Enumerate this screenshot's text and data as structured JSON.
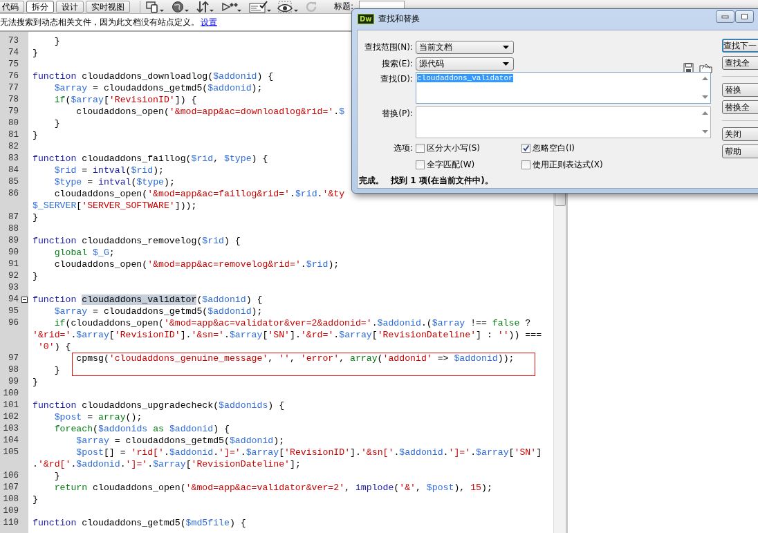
{
  "toolbar": {
    "tabs": [
      {
        "label": "代码",
        "selected": false
      },
      {
        "label": "拆分",
        "selected": true
      },
      {
        "label": "设计",
        "selected": false
      },
      {
        "label": "实时视图",
        "selected": false
      }
    ],
    "title_label": "标题:"
  },
  "info_bar": {
    "message": "无法搜索到动态相关文件，因为此文档没有站点定义。",
    "link": "设置"
  },
  "code": {
    "lines": [
      {
        "number": "73",
        "rows": [
          {
            "tokens": [
              {
                "kind": "plain",
                "text": "    }"
              }
            ]
          }
        ]
      },
      {
        "number": "74",
        "rows": [
          {
            "tokens": [
              {
                "kind": "plain",
                "text": "}"
              }
            ]
          }
        ]
      },
      {
        "number": "75"
      },
      {
        "number": "76",
        "rows": [
          {
            "tokens": [
              {
                "kind": "kw",
                "text": "function"
              },
              {
                "kind": "plain",
                "text": " cloudaddons_downloadlog("
              },
              {
                "kind": "var",
                "text": "$addonid"
              },
              {
                "kind": "plain",
                "text": ") {"
              }
            ]
          }
        ]
      },
      {
        "number": "77",
        "rows": [
          {
            "tokens": [
              {
                "kind": "var",
                "text": "    $array"
              },
              {
                "kind": "plain",
                "text": " = cloudaddons_getmd5("
              },
              {
                "kind": "var",
                "text": "$addonid"
              },
              {
                "kind": "plain",
                "text": ");"
              }
            ]
          }
        ]
      },
      {
        "number": "78",
        "rows": [
          {
            "tokens": [
              {
                "kind": "ctl",
                "text": "    if"
              },
              {
                "kind": "plain",
                "text": "("
              },
              {
                "kind": "var",
                "text": "$array"
              },
              {
                "kind": "plain",
                "text": "["
              },
              {
                "kind": "str",
                "text": "'RevisionID'"
              },
              {
                "kind": "plain",
                "text": "]) {"
              }
            ]
          }
        ]
      },
      {
        "number": "79",
        "rows": [
          {
            "tokens": [
              {
                "kind": "plain",
                "text": "        cloudaddons_open("
              },
              {
                "kind": "str",
                "text": "'&mod=app&ac=downloadlog&rid='"
              },
              {
                "kind": "plain",
                "text": "."
              },
              {
                "kind": "var",
                "text": "$"
              }
            ]
          }
        ]
      },
      {
        "number": "80",
        "rows": [
          {
            "tokens": [
              {
                "kind": "plain",
                "text": "    }"
              }
            ]
          }
        ]
      },
      {
        "number": "81",
        "rows": [
          {
            "tokens": [
              {
                "kind": "plain",
                "text": "}"
              }
            ]
          }
        ]
      },
      {
        "number": "82"
      },
      {
        "number": "83",
        "rows": [
          {
            "tokens": [
              {
                "kind": "kw",
                "text": "function"
              },
              {
                "kind": "plain",
                "text": " cloudaddons_faillog("
              },
              {
                "kind": "var",
                "text": "$rid"
              },
              {
                "kind": "plain",
                "text": ", "
              },
              {
                "kind": "var",
                "text": "$type"
              },
              {
                "kind": "plain",
                "text": ") {"
              }
            ]
          }
        ]
      },
      {
        "number": "84",
        "rows": [
          {
            "tokens": [
              {
                "kind": "var",
                "text": "    $rid"
              },
              {
                "kind": "plain",
                "text": " = "
              },
              {
                "kind": "kw",
                "text": "intval"
              },
              {
                "kind": "plain",
                "text": "("
              },
              {
                "kind": "var",
                "text": "$rid"
              },
              {
                "kind": "plain",
                "text": ");"
              }
            ]
          }
        ]
      },
      {
        "number": "85",
        "rows": [
          {
            "tokens": [
              {
                "kind": "var",
                "text": "    $type"
              },
              {
                "kind": "plain",
                "text": " = "
              },
              {
                "kind": "kw",
                "text": "intval"
              },
              {
                "kind": "plain",
                "text": "("
              },
              {
                "kind": "var",
                "text": "$type"
              },
              {
                "kind": "plain",
                "text": ");"
              }
            ]
          }
        ]
      },
      {
        "number": "86",
        "rows": [
          {
            "tokens": [
              {
                "kind": "plain",
                "text": "    cloudaddons_open("
              },
              {
                "kind": "str",
                "text": "'&mod=app&ac=faillog&rid='"
              },
              {
                "kind": "plain",
                "text": "."
              },
              {
                "kind": "var",
                "text": "$rid"
              },
              {
                "kind": "plain",
                "text": "."
              },
              {
                "kind": "str",
                "text": "'&ty"
              }
            ]
          },
          {
            "tokens": [
              {
                "kind": "var",
                "text": "$_SERVER"
              },
              {
                "kind": "plain",
                "text": "["
              },
              {
                "kind": "str",
                "text": "'SERVER_SOFTWARE'"
              },
              {
                "kind": "plain",
                "text": "]));"
              }
            ]
          }
        ]
      },
      {
        "number": "87",
        "rows": [
          {
            "tokens": [
              {
                "kind": "plain",
                "text": "}"
              }
            ]
          }
        ]
      },
      {
        "number": "88"
      },
      {
        "number": "89",
        "rows": [
          {
            "tokens": [
              {
                "kind": "kw",
                "text": "function"
              },
              {
                "kind": "plain",
                "text": " cloudaddons_removelog("
              },
              {
                "kind": "var",
                "text": "$rid"
              },
              {
                "kind": "plain",
                "text": ") {"
              }
            ]
          }
        ]
      },
      {
        "number": "90",
        "rows": [
          {
            "tokens": [
              {
                "kind": "ctl",
                "text": "    global"
              },
              {
                "kind": "var",
                "text": " $_G"
              },
              {
                "kind": "plain",
                "text": ";"
              }
            ]
          }
        ]
      },
      {
        "number": "91",
        "rows": [
          {
            "tokens": [
              {
                "kind": "plain",
                "text": "    cloudaddons_open("
              },
              {
                "kind": "str",
                "text": "'&mod=app&ac=removelog&rid='"
              },
              {
                "kind": "plain",
                "text": "."
              },
              {
                "kind": "var",
                "text": "$rid"
              },
              {
                "kind": "plain",
                "text": ");"
              }
            ]
          }
        ]
      },
      {
        "number": "92",
        "rows": [
          {
            "tokens": [
              {
                "kind": "plain",
                "text": "}"
              }
            ]
          }
        ]
      },
      {
        "number": "93"
      },
      {
        "number": "94",
        "fold": true,
        "rows": [
          {
            "tokens": [
              {
                "kind": "kw",
                "text": "function "
              },
              {
                "kind": "match",
                "text": "cloudaddons_validator"
              },
              {
                "kind": "plain",
                "text": "("
              },
              {
                "kind": "var",
                "text": "$addonid"
              },
              {
                "kind": "plain",
                "text": ") {"
              }
            ]
          }
        ]
      },
      {
        "number": "95",
        "rows": [
          {
            "tokens": [
              {
                "kind": "var",
                "text": "    $array"
              },
              {
                "kind": "plain",
                "text": " = cloudaddons_getmd5("
              },
              {
                "kind": "var",
                "text": "$addonid"
              },
              {
                "kind": "plain",
                "text": ");"
              }
            ]
          }
        ]
      },
      {
        "number": "96",
        "rows": [
          {
            "tokens": [
              {
                "kind": "ctl",
                "text": "    if"
              },
              {
                "kind": "plain",
                "text": "(cloudaddons_open("
              },
              {
                "kind": "str",
                "text": "'&mod=app&ac=validator&ver=2&addonid='"
              },
              {
                "kind": "plain",
                "text": "."
              },
              {
                "kind": "var",
                "text": "$addonid"
              },
              {
                "kind": "plain",
                "text": ".("
              },
              {
                "kind": "var",
                "text": "$array"
              },
              {
                "kind": "plain",
                "text": " !== "
              },
              {
                "kind": "ctl",
                "text": "false"
              },
              {
                "kind": "plain",
                "text": " ?"
              }
            ]
          },
          {
            "tokens": [
              {
                "kind": "str",
                "text": "'&rid='"
              },
              {
                "kind": "plain",
                "text": "."
              },
              {
                "kind": "var",
                "text": "$array"
              },
              {
                "kind": "plain",
                "text": "["
              },
              {
                "kind": "str",
                "text": "'RevisionID'"
              },
              {
                "kind": "plain",
                "text": "]."
              },
              {
                "kind": "str",
                "text": "'&sn='"
              },
              {
                "kind": "plain",
                "text": "."
              },
              {
                "kind": "var",
                "text": "$array"
              },
              {
                "kind": "plain",
                "text": "["
              },
              {
                "kind": "str",
                "text": "'SN'"
              },
              {
                "kind": "plain",
                "text": "]."
              },
              {
                "kind": "str",
                "text": "'&rd='"
              },
              {
                "kind": "plain",
                "text": "."
              },
              {
                "kind": "var",
                "text": "$array"
              },
              {
                "kind": "plain",
                "text": "["
              },
              {
                "kind": "str",
                "text": "'RevisionDateline'"
              },
              {
                "kind": "plain",
                "text": "] : "
              },
              {
                "kind": "str",
                "text": "''"
              },
              {
                "kind": "plain",
                "text": ")) ==="
              }
            ]
          },
          {
            "tokens": [
              {
                "kind": "str",
                "text": " '0'"
              },
              {
                "kind": "plain",
                "text": ") {"
              }
            ]
          }
        ]
      },
      {
        "number": "97",
        "boxed": true,
        "rows": [
          {
            "tokens": [
              {
                "kind": "plain",
                "text": "        cpmsg("
              },
              {
                "kind": "str",
                "text": "'cloudaddons_genuine_message'"
              },
              {
                "kind": "plain",
                "text": ", "
              },
              {
                "kind": "str",
                "text": "''"
              },
              {
                "kind": "plain",
                "text": ", "
              },
              {
                "kind": "str",
                "text": "'error'"
              },
              {
                "kind": "plain",
                "text": ", "
              },
              {
                "kind": "ctl",
                "text": "array"
              },
              {
                "kind": "plain",
                "text": "("
              },
              {
                "kind": "str",
                "text": "'addonid'"
              },
              {
                "kind": "plain",
                "text": " => "
              },
              {
                "kind": "var",
                "text": "$addonid"
              },
              {
                "kind": "plain",
                "text": "));"
              }
            ]
          }
        ]
      },
      {
        "number": "98",
        "boxed": true,
        "rows": [
          {
            "tokens": [
              {
                "kind": "plain",
                "text": "    }"
              }
            ]
          }
        ]
      },
      {
        "number": "99",
        "rows": [
          {
            "tokens": [
              {
                "kind": "plain",
                "text": "}"
              }
            ]
          }
        ]
      },
      {
        "number": "100"
      },
      {
        "number": "101",
        "rows": [
          {
            "tokens": [
              {
                "kind": "kw",
                "text": "function"
              },
              {
                "kind": "plain",
                "text": " cloudaddons_upgradecheck("
              },
              {
                "kind": "var",
                "text": "$addonids"
              },
              {
                "kind": "plain",
                "text": ") {"
              }
            ]
          }
        ]
      },
      {
        "number": "102",
        "rows": [
          {
            "tokens": [
              {
                "kind": "var",
                "text": "    $post"
              },
              {
                "kind": "plain",
                "text": " = "
              },
              {
                "kind": "ctl",
                "text": "array"
              },
              {
                "kind": "plain",
                "text": "();"
              }
            ]
          }
        ]
      },
      {
        "number": "103",
        "rows": [
          {
            "tokens": [
              {
                "kind": "ctl",
                "text": "    foreach"
              },
              {
                "kind": "plain",
                "text": "("
              },
              {
                "kind": "var",
                "text": "$addonids"
              },
              {
                "kind": "ctl",
                "text": " as"
              },
              {
                "kind": "var",
                "text": " $addonid"
              },
              {
                "kind": "plain",
                "text": ") {"
              }
            ]
          }
        ]
      },
      {
        "number": "104",
        "rows": [
          {
            "tokens": [
              {
                "kind": "var",
                "text": "        $array"
              },
              {
                "kind": "plain",
                "text": " = cloudaddons_getmd5("
              },
              {
                "kind": "var",
                "text": "$addonid"
              },
              {
                "kind": "plain",
                "text": ");"
              }
            ]
          }
        ]
      },
      {
        "number": "105",
        "rows": [
          {
            "tokens": [
              {
                "kind": "var",
                "text": "        $post"
              },
              {
                "kind": "plain",
                "text": "[] = "
              },
              {
                "kind": "str",
                "text": "'rid['"
              },
              {
                "kind": "plain",
                "text": "."
              },
              {
                "kind": "var",
                "text": "$addonid"
              },
              {
                "kind": "plain",
                "text": "."
              },
              {
                "kind": "str",
                "text": "']='"
              },
              {
                "kind": "plain",
                "text": "."
              },
              {
                "kind": "var",
                "text": "$array"
              },
              {
                "kind": "plain",
                "text": "["
              },
              {
                "kind": "str",
                "text": "'RevisionID'"
              },
              {
                "kind": "plain",
                "text": "]."
              },
              {
                "kind": "str",
                "text": "'&sn['"
              },
              {
                "kind": "plain",
                "text": "."
              },
              {
                "kind": "var",
                "text": "$addonid"
              },
              {
                "kind": "plain",
                "text": "."
              },
              {
                "kind": "str",
                "text": "']='"
              },
              {
                "kind": "plain",
                "text": "."
              },
              {
                "kind": "var",
                "text": "$array"
              },
              {
                "kind": "plain",
                "text": "["
              },
              {
                "kind": "str",
                "text": "'SN'"
              },
              {
                "kind": "plain",
                "text": "]"
              }
            ]
          },
          {
            "tokens": [
              {
                "kind": "plain",
                "text": "."
              },
              {
                "kind": "str",
                "text": "'&rd['"
              },
              {
                "kind": "plain",
                "text": "."
              },
              {
                "kind": "var",
                "text": "$addonid"
              },
              {
                "kind": "plain",
                "text": "."
              },
              {
                "kind": "str",
                "text": "']='"
              },
              {
                "kind": "plain",
                "text": "."
              },
              {
                "kind": "var",
                "text": "$array"
              },
              {
                "kind": "plain",
                "text": "["
              },
              {
                "kind": "str",
                "text": "'RevisionDateline'"
              },
              {
                "kind": "plain",
                "text": "];"
              }
            ]
          }
        ]
      },
      {
        "number": "106",
        "rows": [
          {
            "tokens": [
              {
                "kind": "plain",
                "text": "    }"
              }
            ]
          }
        ]
      },
      {
        "number": "107",
        "rows": [
          {
            "tokens": [
              {
                "kind": "ctl",
                "text": "    return"
              },
              {
                "kind": "plain",
                "text": " cloudaddons_open("
              },
              {
                "kind": "str",
                "text": "'&mod=app&ac=validator&ver=2'"
              },
              {
                "kind": "plain",
                "text": ", "
              },
              {
                "kind": "kw",
                "text": "implode"
              },
              {
                "kind": "plain",
                "text": "("
              },
              {
                "kind": "str",
                "text": "'&'"
              },
              {
                "kind": "plain",
                "text": ", "
              },
              {
                "kind": "var",
                "text": "$post"
              },
              {
                "kind": "plain",
                "text": "), "
              },
              {
                "kind": "num",
                "text": "15"
              },
              {
                "kind": "plain",
                "text": ");"
              }
            ]
          }
        ]
      },
      {
        "number": "108",
        "rows": [
          {
            "tokens": [
              {
                "kind": "plain",
                "text": "}"
              }
            ]
          }
        ]
      },
      {
        "number": "109"
      },
      {
        "number": "110",
        "rows": [
          {
            "tokens": [
              {
                "kind": "kw",
                "text": "function"
              },
              {
                "kind": "plain",
                "text": " cloudaddons_getmd5("
              },
              {
                "kind": "var",
                "text": "$md5file"
              },
              {
                "kind": "plain",
                "text": ") {"
              }
            ]
          }
        ]
      }
    ]
  },
  "dialog": {
    "logo": "Dw",
    "title": "查找和替换",
    "fields": [
      {
        "kind": "select",
        "label": "查找范围(N):",
        "value": "当前文档"
      },
      {
        "kind": "select",
        "label": "搜索(E):",
        "value": "源代码"
      },
      {
        "kind": "textarea",
        "label": "查找(D):",
        "value": "cloudaddons_validator",
        "selected": true
      },
      {
        "kind": "textarea",
        "label": "替换(P):"
      }
    ],
    "options_label": "选项:",
    "options": [
      {
        "label": "区分大小写(S)",
        "checked": false
      },
      {
        "label": "忽略空白(I)",
        "checked": true
      },
      {
        "label": "全字匹配(W)",
        "checked": false
      },
      {
        "label": "使用正则表达式(X)",
        "checked": false
      }
    ],
    "status": [
      "完成。",
      "找到 1 项(在当前文件中)。"
    ],
    "buttons": [
      {
        "label": "查找下一",
        "focused": true
      },
      {
        "label": "查找全",
        "focused": false
      },
      {
        "label": "替换",
        "focused": false,
        "separator_before": true
      },
      {
        "label": "替换全",
        "focused": false
      },
      {
        "label": "关闭",
        "focused": false,
        "separator_before": true
      },
      {
        "label": "帮助",
        "focused": false
      }
    ]
  }
}
